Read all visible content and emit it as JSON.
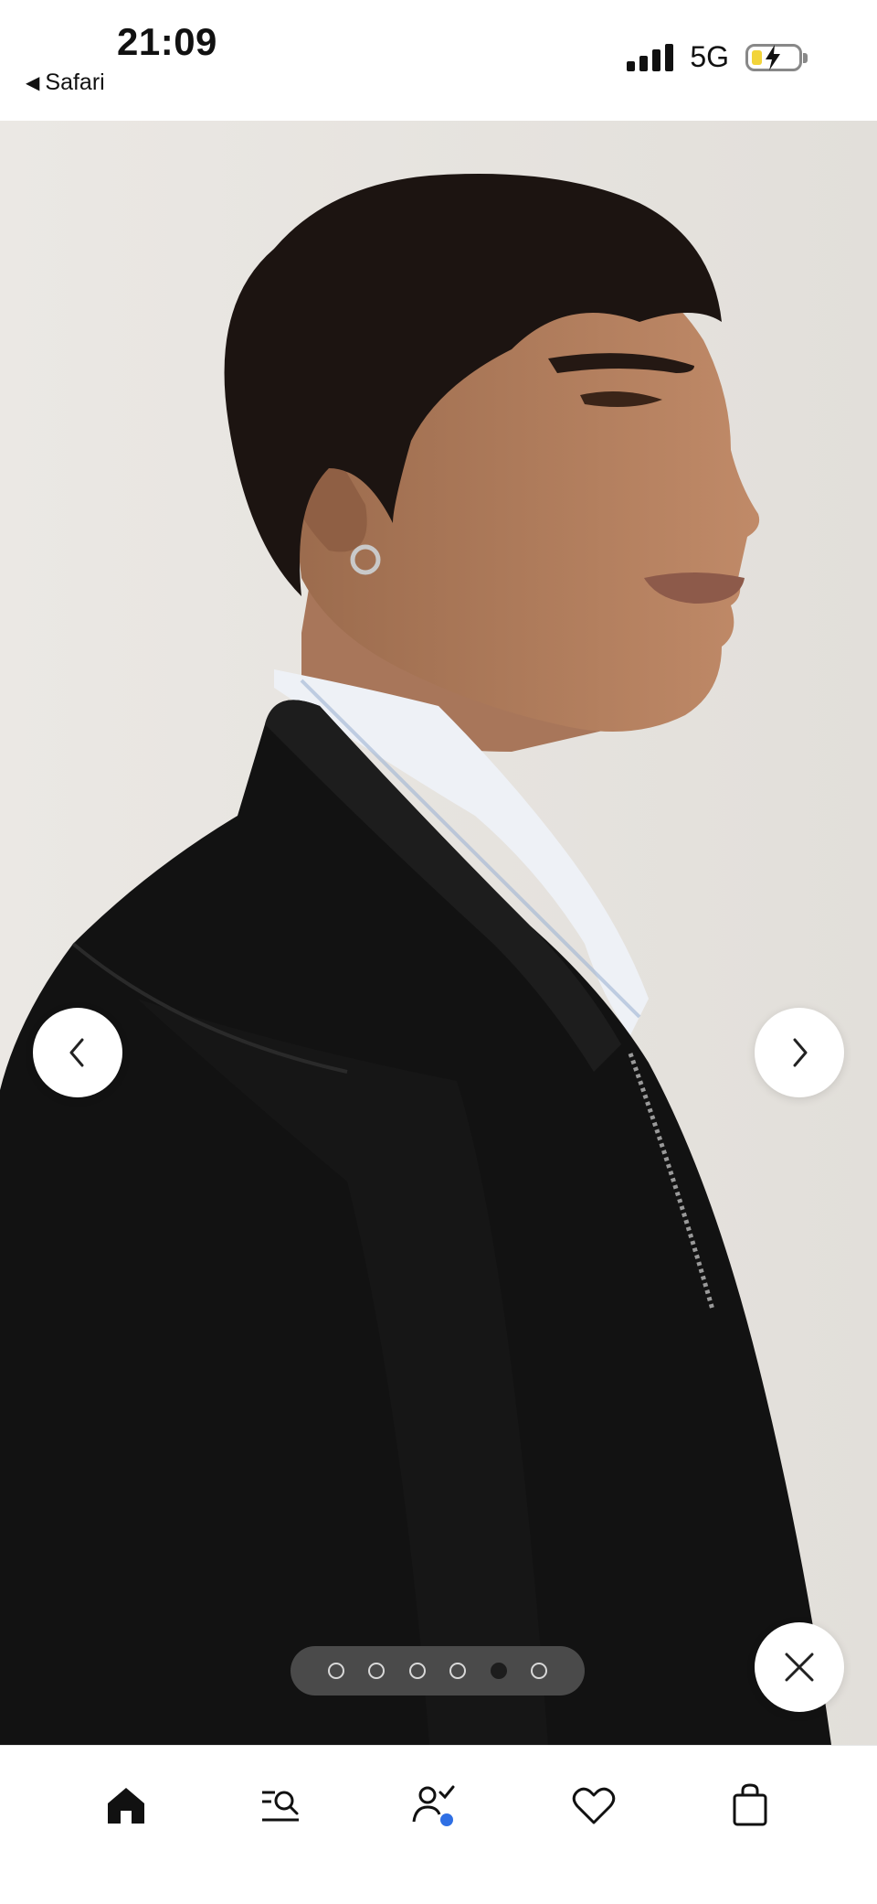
{
  "status_bar": {
    "time": "21:09",
    "back_label": "Safari",
    "network": "5G",
    "battery_icon": "battery-charging-icon",
    "signal_icon": "signal-bars-icon"
  },
  "viewer": {
    "image_subject": "product-photo",
    "dots_total": 6,
    "active_dot_index": 4,
    "buttons": {
      "prev_icon": "chevron-left-icon",
      "next_icon": "chevron-right-icon",
      "close_icon": "close-icon"
    }
  },
  "tabbar": {
    "items": [
      {
        "id": "home",
        "icon": "home-icon",
        "selected": true
      },
      {
        "id": "search",
        "icon": "search-list-icon",
        "selected": false
      },
      {
        "id": "account",
        "icon": "account-check-icon",
        "selected": false,
        "badge_color": "#2f6fe4"
      },
      {
        "id": "wishlist",
        "icon": "heart-icon",
        "selected": false
      },
      {
        "id": "bag",
        "icon": "bag-icon",
        "selected": false
      }
    ]
  },
  "colors": {
    "background": "#e8e5e1",
    "jacket": "#121212",
    "badge": "#2f6fe4",
    "battery_fill": "#f2d43a"
  }
}
